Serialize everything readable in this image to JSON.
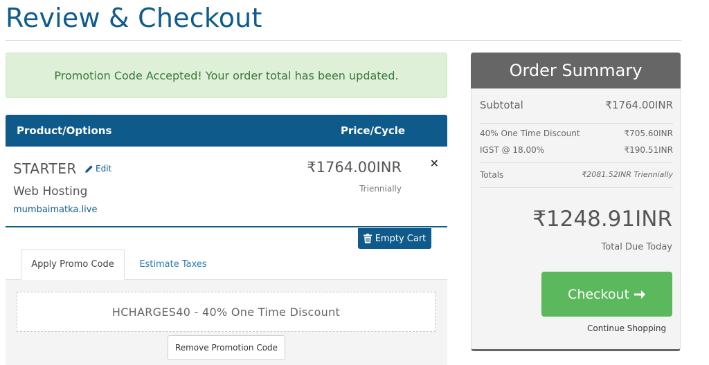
{
  "page": {
    "title": "Review & Checkout"
  },
  "alert": {
    "text": "Promotion Code Accepted! Your order total has been updated."
  },
  "cart": {
    "header": {
      "product": "Product/Options",
      "price": "Price/Cycle"
    },
    "item": {
      "name": "STARTER",
      "edit_label": "Edit",
      "group": "Web Hosting",
      "domain": "mumbaimatka.live",
      "price": "₹1764.00INR",
      "cycle": "Triennially",
      "remove_glyph": "×"
    },
    "empty_cart_label": "Empty Cart"
  },
  "tabs": [
    {
      "label": "Apply Promo Code",
      "active": true
    },
    {
      "label": "Estimate Taxes",
      "active": false
    }
  ],
  "promo": {
    "applied_text": "HCHARGES40 - 40% One Time Discount",
    "remove_label": "Remove Promotion Code"
  },
  "summary": {
    "title": "Order Summary",
    "subtotal_label": "Subtotal",
    "subtotal_value": "₹1764.00INR",
    "discount_label": "40% One Time Discount",
    "discount_value": "₹705.60INR",
    "tax_label": "IGST @ 18.00%",
    "tax_value": "₹190.51INR",
    "totals_label": "Totals",
    "totals_value": "₹2081.52INR Triennially",
    "due_amount": "₹1248.91INR",
    "due_label": "Total Due Today",
    "checkout_label": "Checkout",
    "continue_label": "Continue Shopping"
  },
  "icons": {
    "edit": "pencil-icon",
    "trash": "trash-icon",
    "checkout_arrow": "arrow-right-icon",
    "remove": "close-icon"
  },
  "colors": {
    "brand_blue": "#0e5a8a",
    "success_green": "#5cb85c",
    "alert_bg": "#dff0d8",
    "summary_header": "#666666"
  }
}
